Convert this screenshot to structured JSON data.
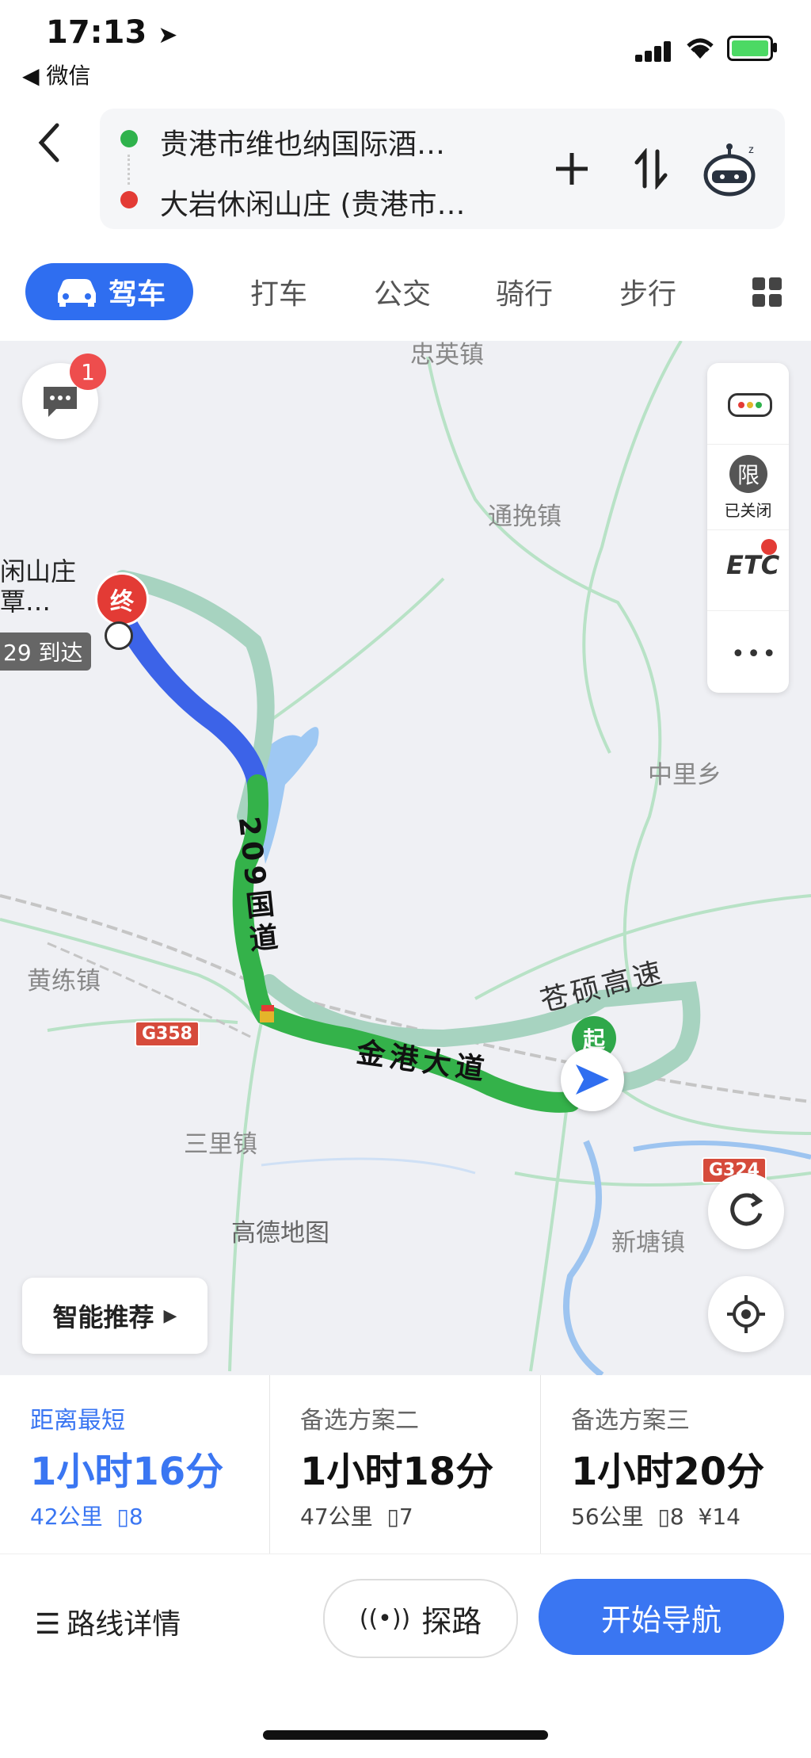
{
  "status_bar": {
    "time": "17:13",
    "back_app": "◀ 微信"
  },
  "route": {
    "origin": "贵港市维也纳国际酒…",
    "destination": "大岩休闲山庄 (贵港市…"
  },
  "modes": [
    "驾车",
    "打车",
    "公交",
    "骑行",
    "步行"
  ],
  "map": {
    "message_badge": "1",
    "side_panel": {
      "restrict_label": "限",
      "restrict_status": "已关闭",
      "etc": "ETC"
    },
    "places": [
      "忠英镇",
      "通挽镇",
      "中里乡",
      "黄练镇",
      "三里镇",
      "新塘镇"
    ],
    "dest_label_line1": "闲山庄",
    "dest_label_line2": "覃…",
    "arrival": "29 到达",
    "end_marker": "终",
    "start_marker": "起",
    "roads": {
      "national": "209国道",
      "avenue": "金港大道",
      "expressway": "苍硕高速"
    },
    "shields": [
      "G358",
      "G324"
    ],
    "watermark": "高德地图",
    "smart_recommend": "智能推荐",
    "colors": {
      "route_blue": "#3c63e8",
      "route_green": "#34b24a",
      "alt_route": "#a7d3c0",
      "accent": "#3a76f2"
    }
  },
  "routes": [
    {
      "label": "距离最短",
      "duration": "1小时16分",
      "distance": "42公里",
      "lights": "8",
      "toll": ""
    },
    {
      "label": "备选方案二",
      "duration": "1小时18分",
      "distance": "47公里",
      "lights": "7",
      "toll": ""
    },
    {
      "label": "备选方案三",
      "duration": "1小时20分",
      "distance": "56公里",
      "lights": "8",
      "toll": "¥14"
    }
  ],
  "actions": {
    "details": "路线详情",
    "explore": "探路",
    "navigate": "开始导航"
  }
}
